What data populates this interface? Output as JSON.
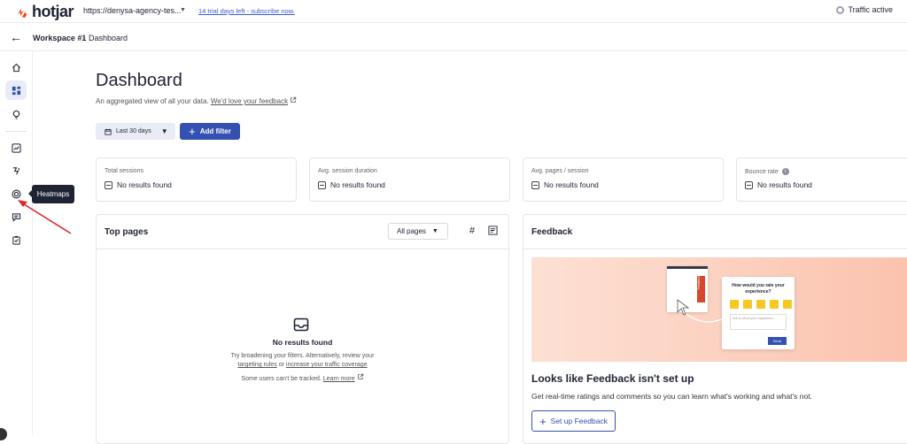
{
  "topbar": {
    "logo": "hotjar",
    "site_url": "https://denysa-agency-tes...",
    "site_caret": "▼",
    "trial_link": "14 trial days left - subscribe now.",
    "traffic_status": "Traffic active"
  },
  "breadcrumb": {
    "back": "←",
    "workspace": "Workspace #1",
    "separator": "/",
    "page": "Dashboard"
  },
  "sidebar": {
    "tooltip": "Heatmaps"
  },
  "header": {
    "title": "Dashboard",
    "subtitle": "An aggregated view of all your data.",
    "feedback_link": "We'd love your feedback"
  },
  "filters": {
    "date_range": "Last 30 days",
    "date_caret": "▼",
    "add_filter": "Add filter"
  },
  "metrics": [
    {
      "label": "Total sessions",
      "value": "No results found"
    },
    {
      "label": "Avg. session duration",
      "value": "No results found"
    },
    {
      "label": "Avg. pages / session",
      "value": "No results found"
    },
    {
      "label": "Bounce rate",
      "value": "No results found"
    }
  ],
  "top_pages": {
    "title": "Top pages",
    "dropdown": "All pages",
    "dropdown_caret": "▼",
    "hash": "#",
    "empty_title": "No results found",
    "empty_line1": "Try broadening your filters. Alternatively, review your",
    "empty_link1": "targeting rules",
    "empty_or": "or",
    "empty_link2": "increase your traffic coverage",
    "empty_note": "Some users can't be tracked.",
    "learn_more": "Learn more"
  },
  "feedback": {
    "title": "Feedback",
    "widget_tab": "Feedback",
    "widget_question": "How would you rate your experience?",
    "widget_placeholder": "Tell us about your experience...",
    "widget_send": "Send",
    "heading": "Looks like Feedback isn't set up",
    "description": "Get real-time ratings and comments so you can learn what's working and what's not.",
    "setup_button": "Set up Feedback"
  },
  "colors": {
    "brand_orange": "#fd3a00",
    "primary_blue": "#3451b2",
    "annotation_red": "#e0262b"
  }
}
